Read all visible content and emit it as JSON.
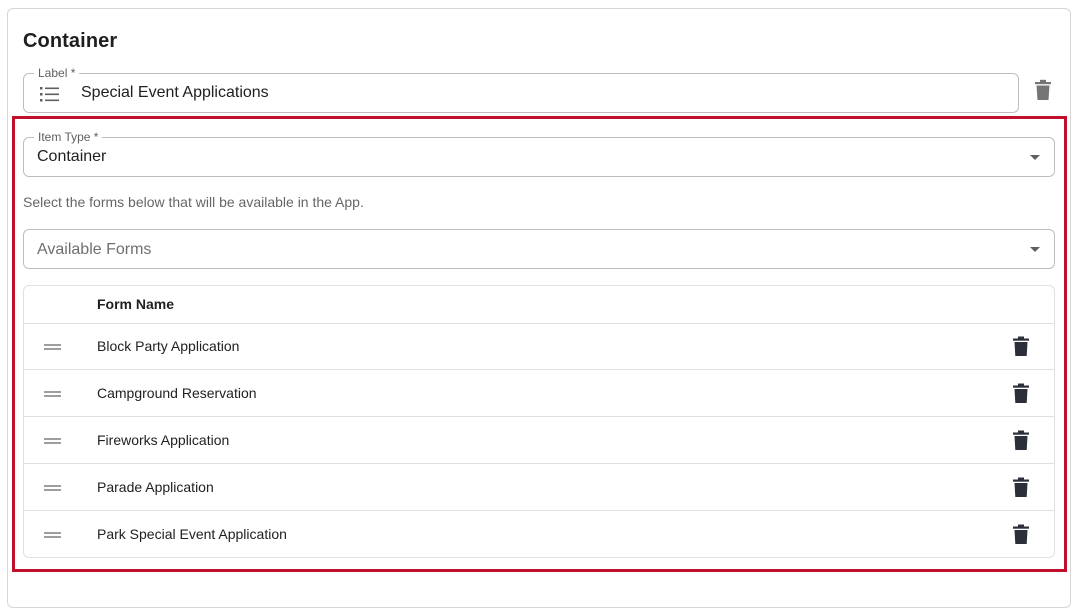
{
  "section": {
    "title": "Container"
  },
  "label_field": {
    "label": "Label *",
    "value": "Special Event Applications",
    "icon": "list-icon"
  },
  "item_type_field": {
    "label": "Item Type *",
    "value": "Container"
  },
  "helper_text": "Select the forms below that will be available in the App.",
  "available_forms": {
    "placeholder": "Available Forms"
  },
  "table": {
    "header": "Form Name",
    "rows": [
      {
        "name": "Block Party Application"
      },
      {
        "name": "Campground Reservation"
      },
      {
        "name": "Fireworks Application"
      },
      {
        "name": "Parade Application"
      },
      {
        "name": "Park Special Event Application"
      }
    ]
  },
  "colors": {
    "highlight": "#c0102a",
    "trash_dark": "#2b2f3a",
    "trash_gray": "#757575"
  }
}
